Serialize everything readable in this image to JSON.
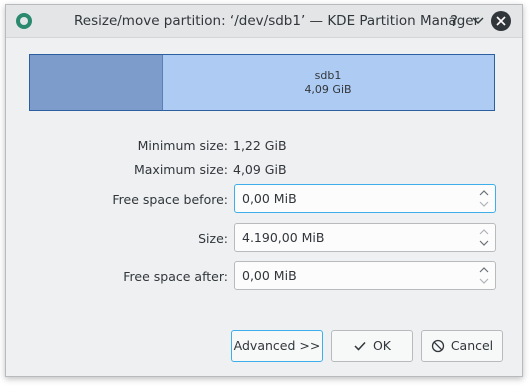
{
  "window": {
    "title": "Resize/move partition: ‘/dev/sdb1’ — KDE Partition Manager",
    "help_label": "?",
    "minimize_label": "⌄",
    "close_label": "✕"
  },
  "partition": {
    "name": "sdb1",
    "size": "4,09 GiB",
    "used_fraction": 0.285,
    "colors": {
      "used": "#7d9bcb",
      "free": "#aecbf3",
      "border": "#2c5fa0"
    }
  },
  "info": {
    "min_label": "Minimum size:",
    "min_value": "1,22 GiB",
    "max_label": "Maximum size:",
    "max_value": "4,09 GiB"
  },
  "fields": {
    "before_label": "Free space before:",
    "before_value": "0,00 MiB",
    "size_label": "Size:",
    "size_value": "4.190,00 MiB",
    "after_label": "Free space after:",
    "after_value": "0,00 MiB"
  },
  "buttons": {
    "advanced": "Advanced >>",
    "ok": "OK",
    "cancel": "Cancel"
  },
  "colors": {
    "accent": "#3daee9",
    "text": "#31363b",
    "window_bg": "#eff0f1"
  }
}
